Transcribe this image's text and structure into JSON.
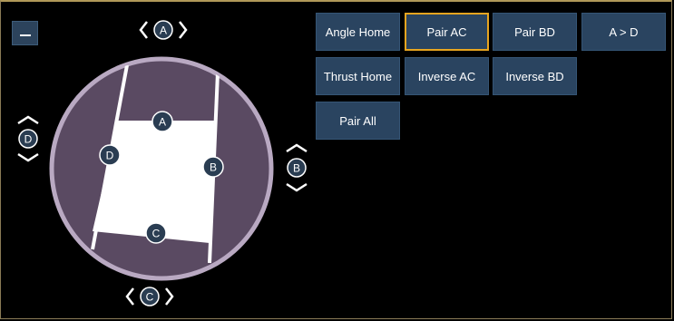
{
  "shutter": {
    "labels": {
      "a": "A",
      "b": "B",
      "c": "C",
      "d": "D"
    }
  },
  "buttons": [
    {
      "label": "Angle Home",
      "selected": false
    },
    {
      "label": "Pair AC",
      "selected": true
    },
    {
      "label": "Pair BD",
      "selected": false
    },
    {
      "label": "A > D",
      "selected": false
    },
    {
      "label": "Thrust Home",
      "selected": false
    },
    {
      "label": "Inverse AC",
      "selected": false
    },
    {
      "label": "Inverse BD",
      "selected": false
    },
    {
      "label": "Pair All",
      "selected": false
    }
  ],
  "colors": {
    "button_bg": "#2a4460",
    "selected_border": "#e7a520",
    "disc": "#5a4a62",
    "disc_ring": "#b9a9c2",
    "badge": "#2a3d52",
    "frame": "#b09858"
  }
}
